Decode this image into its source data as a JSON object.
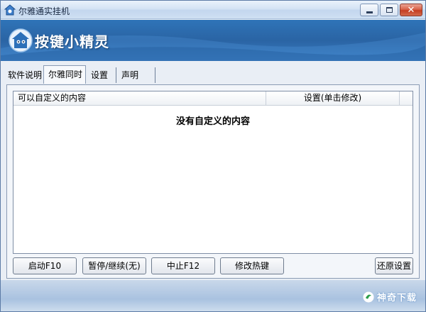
{
  "window": {
    "title": "尔雅通实挂机"
  },
  "banner": {
    "logo_text": "按键小精灵"
  },
  "tabs": [
    {
      "label": "软件说明",
      "active": false
    },
    {
      "label": "尔雅同时",
      "active": true
    },
    {
      "label": "设置",
      "active": false
    },
    {
      "label": "声明",
      "active": false
    }
  ],
  "list": {
    "columns": [
      "可以自定义的内容",
      "设置(单击修改)"
    ],
    "empty_text": "没有自定义的内容"
  },
  "buttons": {
    "start": "启动F10",
    "pause": "暂停/继续(无)",
    "stop": "中止F12",
    "hotkey": "修改热键",
    "restore": "还原设置"
  },
  "watermark": {
    "text": "神奇下载"
  },
  "colors": {
    "banner": "#2a64a4",
    "close_button": "#c43e22"
  }
}
